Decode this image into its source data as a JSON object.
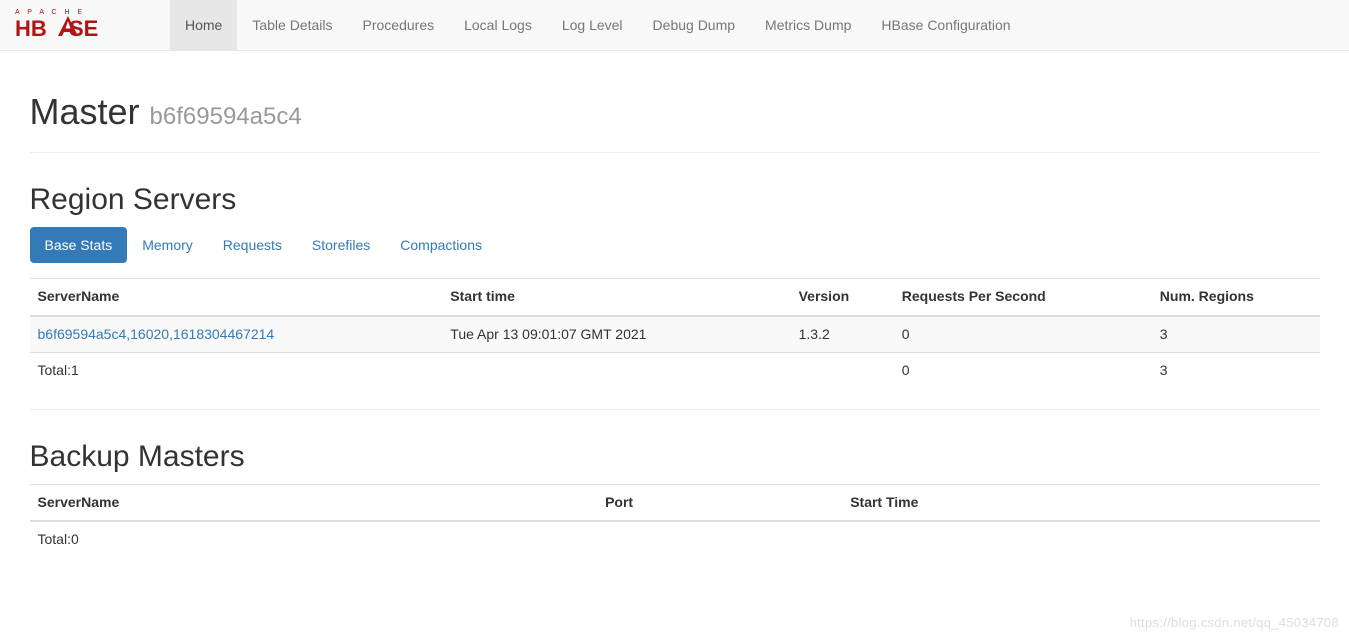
{
  "brand": {
    "top": "A P A C H E",
    "bottom": "HBASE"
  },
  "nav": {
    "items": [
      {
        "label": "Home",
        "active": true
      },
      {
        "label": "Table Details",
        "active": false
      },
      {
        "label": "Procedures",
        "active": false
      },
      {
        "label": "Local Logs",
        "active": false
      },
      {
        "label": "Log Level",
        "active": false
      },
      {
        "label": "Debug Dump",
        "active": false
      },
      {
        "label": "Metrics Dump",
        "active": false
      },
      {
        "label": "HBase Configuration",
        "active": false
      }
    ]
  },
  "header": {
    "title": "Master",
    "subtitle": "b6f69594a5c4"
  },
  "region_servers": {
    "heading": "Region Servers",
    "tabs": [
      {
        "label": "Base Stats",
        "active": true
      },
      {
        "label": "Memory",
        "active": false
      },
      {
        "label": "Requests",
        "active": false
      },
      {
        "label": "Storefiles",
        "active": false
      },
      {
        "label": "Compactions",
        "active": false
      }
    ],
    "columns": {
      "server_name": "ServerName",
      "start_time": "Start time",
      "version": "Version",
      "rps": "Requests Per Second",
      "num_regions": "Num. Regions"
    },
    "rows": [
      {
        "server_name": "b6f69594a5c4,16020,1618304467214",
        "start_time": "Tue Apr 13 09:01:07 GMT 2021",
        "version": "1.3.2",
        "rps": "0",
        "num_regions": "3"
      }
    ],
    "totals": {
      "label": "Total:1",
      "rps": "0",
      "num_regions": "3"
    }
  },
  "backup_masters": {
    "heading": "Backup Masters",
    "columns": {
      "server_name": "ServerName",
      "port": "Port",
      "start_time": "Start Time"
    },
    "totals": {
      "label": "Total:0"
    }
  },
  "watermark": "https://blog.csdn.net/qq_45034708"
}
